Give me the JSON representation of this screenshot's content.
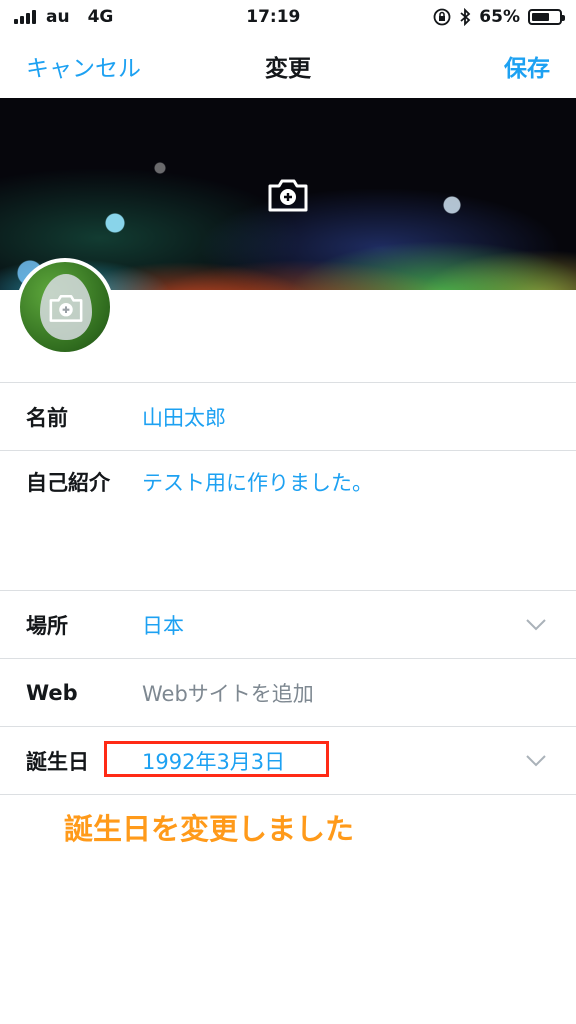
{
  "status_bar": {
    "carrier": "au",
    "network": "4G",
    "time": "17:19",
    "battery_percent": "65%",
    "battery_level": 0.65
  },
  "nav": {
    "cancel_label": "キャンセル",
    "title": "変更",
    "save_label": "保存"
  },
  "profile_fields": {
    "name": {
      "label": "名前",
      "value": "山田太郎"
    },
    "bio": {
      "label": "自己紹介",
      "value": "テスト用に作りました。"
    },
    "location": {
      "label": "場所",
      "value": "日本"
    },
    "web": {
      "label": "Web",
      "placeholder": "Webサイトを追加"
    },
    "birthday": {
      "label": "誕生日",
      "value": "1992年3月3日"
    }
  },
  "annotation": {
    "text": "誕生日を変更しました",
    "color": "#ff9a1a",
    "highlight_color": "#ff2a15"
  },
  "icons": [
    "camera-plus-icon",
    "chevron-down-icon",
    "bluetooth-icon",
    "rotation-lock-icon",
    "battery-icon",
    "signal-icon"
  ],
  "colors": {
    "accent": "#1da1f2",
    "text": "#14171a",
    "placeholder": "#7e8891",
    "divider": "#dcdfe2"
  }
}
